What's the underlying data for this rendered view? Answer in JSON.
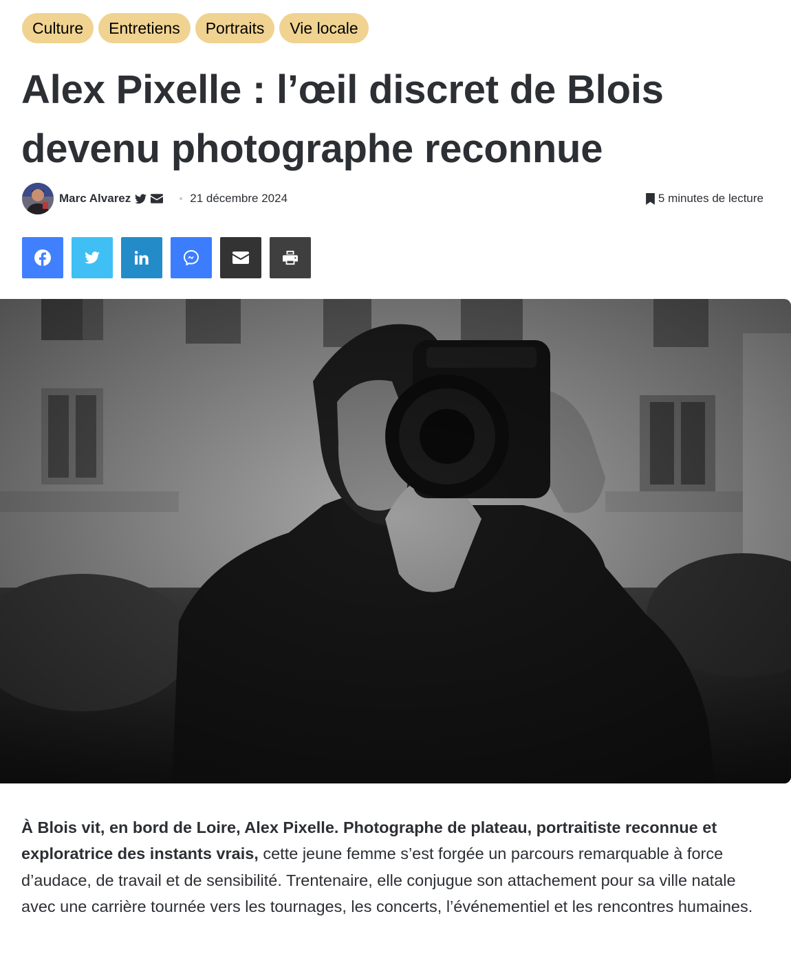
{
  "categories": [
    "Culture",
    "Entretiens",
    "Portraits",
    "Vie locale"
  ],
  "article": {
    "title": "Alex Pixelle : l’œil discret de Blois devenu photographe reconnue",
    "author": "Marc Alvarez",
    "date": "21 décembre 2024",
    "reading_time": "5 minutes de lecture",
    "intro_bold": "À Blois vit, en bord de Loire, Alex Pixelle. Photographe de plateau, portraitiste reconnue et exploratrice des instants vrais,",
    "intro_rest": " cette jeune femme s’est forgée un parcours remarquable à force d’audace, de travail et de sensibilité. Trentenaire, elle conjugue son attachement pour sa ville natale avec une carrière tournée vers les tournages, les concerts, l’événementiel et les rencontres humaines."
  },
  "share": [
    {
      "name": "facebook",
      "icon": "facebook-icon",
      "color": "#4080ff"
    },
    {
      "name": "twitter",
      "icon": "twitter-icon",
      "color": "#40bff5"
    },
    {
      "name": "linkedin",
      "icon": "linkedin-icon",
      "color": "#238cc8"
    },
    {
      "name": "messenger",
      "icon": "messenger-icon",
      "color": "#3c7dfe"
    },
    {
      "name": "email",
      "icon": "envelope-icon",
      "color": "#333333"
    },
    {
      "name": "print",
      "icon": "printer-icon",
      "color": "#3f3f3f"
    }
  ],
  "colors": {
    "tag_background": "#f0d391",
    "text": "#2c2f34"
  }
}
